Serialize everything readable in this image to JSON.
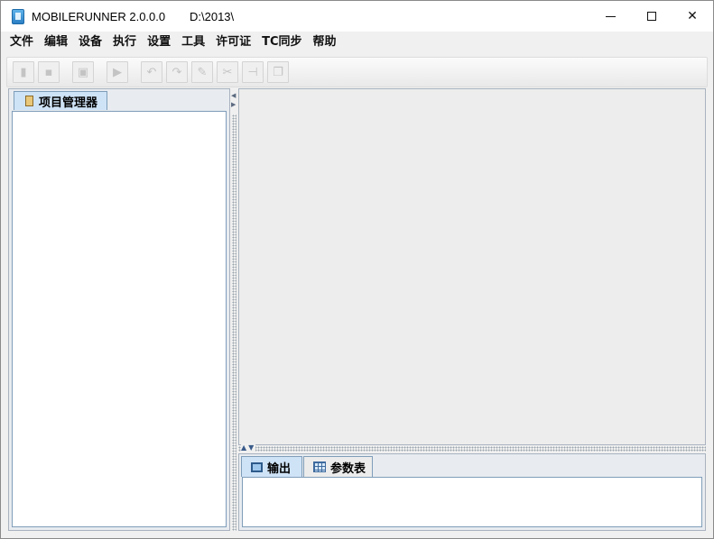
{
  "window": {
    "title": "MOBILERUNNER 2.0.0.0",
    "path": "D:\\2013\\",
    "controls": {
      "minimize_icon": "minimize-icon",
      "maximize_icon": "maximize-icon",
      "close_glyph": "✕"
    }
  },
  "menu": {
    "items": [
      "文件",
      "编辑",
      "设备",
      "执行",
      "设置",
      "工具",
      "许可证",
      "TC同步",
      "帮助"
    ]
  },
  "toolbar": {
    "buttons": [
      {
        "icon": "new-file-icon",
        "glyph": "▮"
      },
      {
        "icon": "save-icon",
        "glyph": "▪"
      },
      {
        "icon": "record-icon",
        "glyph": "▣"
      },
      {
        "icon": "play-icon",
        "glyph": "▶"
      },
      {
        "icon": "undo-icon",
        "glyph": "↶"
      },
      {
        "icon": "redo-icon",
        "glyph": "↷"
      },
      {
        "icon": "edit-icon",
        "glyph": "✎"
      },
      {
        "icon": "cut-icon",
        "glyph": "✂"
      },
      {
        "icon": "step-icon",
        "glyph": "⊣"
      },
      {
        "icon": "window-icon",
        "glyph": "❐"
      }
    ],
    "disabled_color": "#c4c4c4"
  },
  "left_panel": {
    "tab_label": "项目管理器"
  },
  "bottom_panel": {
    "tabs": [
      {
        "label": "输出",
        "selected": true
      },
      {
        "label": "参数表",
        "selected": false
      }
    ]
  },
  "colors": {
    "selected_tab": "#cfe3f7",
    "panel_border": "#7f9db9",
    "editor_bg": "#ededed"
  }
}
